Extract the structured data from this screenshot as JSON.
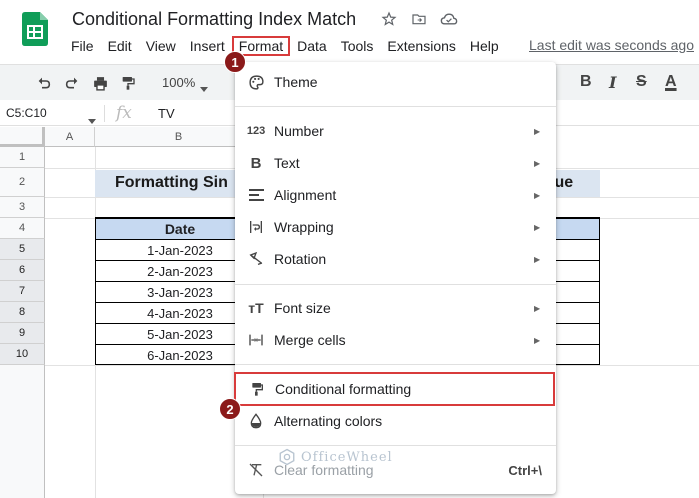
{
  "app": {
    "doc_title": "Conditional Formatting Index Match",
    "last_edit": "Last edit was seconds ago"
  },
  "menubar": {
    "items": [
      {
        "label": "File"
      },
      {
        "label": "Edit"
      },
      {
        "label": "View"
      },
      {
        "label": "Insert"
      },
      {
        "label": "Format",
        "active": true
      },
      {
        "label": "Data"
      },
      {
        "label": "Tools"
      },
      {
        "label": "Extensions"
      },
      {
        "label": "Help"
      }
    ]
  },
  "toolbar": {
    "zoom": "100%",
    "icons": [
      "undo-icon",
      "redo-icon",
      "print-icon",
      "paint-format-icon"
    ],
    "format_buttons": [
      "B",
      "I",
      "S",
      "A"
    ]
  },
  "formula_bar": {
    "name_box": "C5:C10",
    "fx": "fx",
    "value": "TV"
  },
  "grid": {
    "columns": [
      "A",
      "B"
    ],
    "rows": [
      "1",
      "2",
      "3",
      "4",
      "5",
      "6",
      "7",
      "8",
      "9",
      "10"
    ],
    "selected_rows": [
      "5",
      "6",
      "7",
      "8",
      "9",
      "10"
    ]
  },
  "sheet": {
    "title_left": "Formatting Sin",
    "title_right": "lue",
    "header_date": "Date",
    "dates": [
      "1-Jan-2023",
      "2-Jan-2023",
      "3-Jan-2023",
      "4-Jan-2023",
      "5-Jan-2023",
      "6-Jan-2023"
    ]
  },
  "format_menu": {
    "theme": "Theme",
    "number": "Number",
    "number_glyph": "123",
    "text": "Text",
    "text_glyph": "B",
    "alignment": "Alignment",
    "wrapping": "Wrapping",
    "rotation": "Rotation",
    "font_size": "Font size",
    "font_size_glyph": "тT",
    "merge_cells": "Merge cells",
    "conditional_formatting": "Conditional formatting",
    "alternating_colors": "Alternating colors",
    "clear_formatting": "Clear formatting",
    "clear_formatting_shortcut": "Ctrl+\\"
  },
  "badges": {
    "step1": "1",
    "step2": "2"
  },
  "watermark": "OfficeWheel",
  "colors": {
    "accent_red": "#d83b3b",
    "badge": "#8b1a1a",
    "title_fill": "#dbe5f1",
    "header_fill": "#c6d9f1",
    "sheets_green": "#0f9d58"
  }
}
